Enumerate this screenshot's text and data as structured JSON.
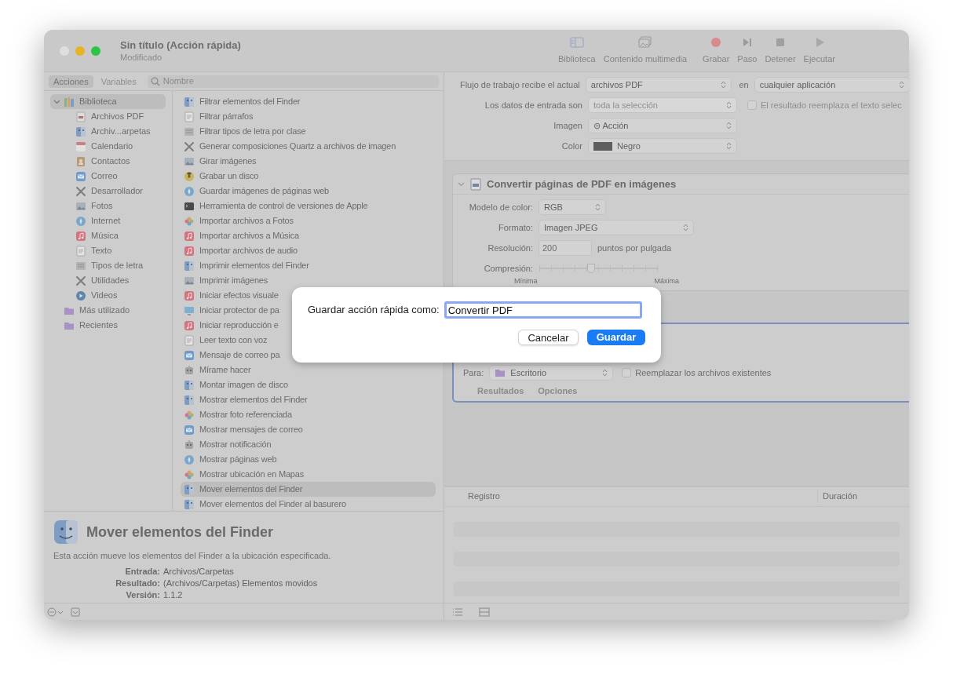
{
  "window": {
    "title": "Sin título (Acción rápida)",
    "subtitle": "Modificado"
  },
  "toolbar": [
    {
      "label": "Biblioteca",
      "kind": "library"
    },
    {
      "label": "Contenido multimedia",
      "kind": "media"
    },
    {
      "label": "Grabar",
      "kind": "record"
    },
    {
      "label": "Paso",
      "kind": "step"
    },
    {
      "label": "Detener",
      "kind": "stop"
    },
    {
      "label": "Ejecutar",
      "kind": "run"
    }
  ],
  "library_tabs": [
    {
      "label": "Acciones",
      "selected": true
    },
    {
      "label": "Variables",
      "selected": false
    }
  ],
  "search": {
    "placeholder": "Nombre"
  },
  "library": [
    {
      "label": "Biblioteca",
      "kind": "library",
      "selected": true,
      "expanded": true,
      "children": [
        {
          "label": "Archivos PDF",
          "kind": "pdf"
        },
        {
          "label": "Archiv...arpetas",
          "kind": "finder"
        },
        {
          "label": "Calendario",
          "kind": "calendar"
        },
        {
          "label": "Contactos",
          "kind": "contacts"
        },
        {
          "label": "Correo",
          "kind": "mail"
        },
        {
          "label": "Desarrollador",
          "kind": "tools"
        },
        {
          "label": "Fotos",
          "kind": "preview"
        },
        {
          "label": "Internet",
          "kind": "safari"
        },
        {
          "label": "Música",
          "kind": "music"
        },
        {
          "label": "Texto",
          "kind": "text"
        },
        {
          "label": "Tipos de letra",
          "kind": "font"
        },
        {
          "label": "Utilidades",
          "kind": "tools"
        },
        {
          "label": "Videos",
          "kind": "video"
        }
      ]
    },
    {
      "label": "Más utilizado",
      "kind": "folder",
      "selected": false
    },
    {
      "label": "Recientes",
      "kind": "folder",
      "selected": false
    }
  ],
  "actions": [
    {
      "label": "Filtrar elementos del Finder",
      "kind": "finder",
      "selected": false
    },
    {
      "label": "Filtrar párrafos",
      "kind": "text",
      "selected": false
    },
    {
      "label": "Filtrar tipos de letra por clase",
      "kind": "font",
      "selected": false
    },
    {
      "label": "Generar composiciones Quartz a archivos de imagen",
      "kind": "tools",
      "selected": false
    },
    {
      "label": "Girar imágenes",
      "kind": "preview",
      "selected": false
    },
    {
      "label": "Grabar un disco",
      "kind": "disc",
      "selected": false
    },
    {
      "label": "Guardar imágenes de páginas web",
      "kind": "safari",
      "selected": false
    },
    {
      "label": "Herramienta de control de versiones de Apple",
      "kind": "terminal",
      "selected": false
    },
    {
      "label": "Importar archivos a Fotos",
      "kind": "photos",
      "selected": false
    },
    {
      "label": "Importar archivos a Música",
      "kind": "music",
      "selected": false
    },
    {
      "label": "Importar archivos de audio",
      "kind": "music",
      "selected": false
    },
    {
      "label": "Imprimir elementos del Finder",
      "kind": "finder",
      "selected": false
    },
    {
      "label": "Imprimir imágenes",
      "kind": "preview",
      "selected": false
    },
    {
      "label": "Iniciar efectos visuale",
      "kind": "music",
      "selected": false
    },
    {
      "label": "Iniciar protector de pa",
      "kind": "screen",
      "selected": false
    },
    {
      "label": "Iniciar reproducción e",
      "kind": "music",
      "selected": false
    },
    {
      "label": "Leer texto con voz",
      "kind": "text",
      "selected": false
    },
    {
      "label": "Mensaje de correo pa",
      "kind": "mail",
      "selected": false
    },
    {
      "label": "Mírame hacer",
      "kind": "robot",
      "selected": false
    },
    {
      "label": "Montar imagen de disco",
      "kind": "finder",
      "selected": false
    },
    {
      "label": "Mostrar elementos del Finder",
      "kind": "finder",
      "selected": false
    },
    {
      "label": "Mostrar foto referenciada",
      "kind": "photos",
      "selected": false
    },
    {
      "label": "Mostrar mensajes de correo",
      "kind": "mail",
      "selected": false
    },
    {
      "label": "Mostrar notificación",
      "kind": "robot",
      "selected": false
    },
    {
      "label": "Mostrar páginas web",
      "kind": "safari",
      "selected": false
    },
    {
      "label": "Mostrar ubicación en Mapas",
      "kind": "photos",
      "selected": false
    },
    {
      "label": "Mover elementos del Finder",
      "kind": "finder",
      "selected": true
    },
    {
      "label": "Mover elementos del Finder al basurero",
      "kind": "finder",
      "selected": false
    }
  ],
  "description": {
    "title": "Mover elementos del Finder",
    "text": "Esta acción mueve los elementos del Finder a la ubicación especificada.",
    "fields": [
      {
        "label": "Entrada:",
        "value": "Archivos/Carpetas"
      },
      {
        "label": "Resultado:",
        "value": "(Archivos/Carpetas) Elementos movidos"
      },
      {
        "label": "Versión:",
        "value": "1.1.2"
      }
    ]
  },
  "workflow_settings": [
    {
      "label": "Flujo de trabajo recibe el actual",
      "value": "archivos PDF",
      "disabled": false,
      "extra_label": "en",
      "extra_value": "cualquier aplicación"
    },
    {
      "label": "Los datos de entrada son",
      "value": "toda la selección",
      "disabled": true,
      "checkbox": {
        "label": "El resultado reemplaza el texto selec",
        "checked": false
      }
    },
    {
      "label": "Imagen",
      "value": "⊝ Acción",
      "disabled": false
    },
    {
      "label": "Color",
      "value": "Negro",
      "disabled": false,
      "swatch": true
    }
  ],
  "action_card": {
    "title": "Convertir páginas de PDF en imágenes",
    "expanded": true,
    "color_model": {
      "label": "Modelo de color:",
      "value": "RGB"
    },
    "format": {
      "label": "Formato:",
      "value": "Imagen JPEG"
    },
    "resolution": {
      "label": "Resolución:",
      "value": "200",
      "unit": "puntos por pulgada"
    },
    "compression": {
      "label": "Compresión:",
      "level": 0.43,
      "min_label": "Mínima",
      "max_label": "Máxima"
    }
  },
  "second_card": {
    "selected": true,
    "to_label": "Para:",
    "to_value": "Escritorio",
    "checkbox": {
      "label": "Reemplazar los archivos existentes",
      "checked": false
    },
    "tabs": [
      "Resultados",
      "Opciones"
    ]
  },
  "log": {
    "columns": [
      "Registro",
      "Duración"
    ]
  },
  "dialog": {
    "label": "Guardar acción rápida como:",
    "value": "Convertir PDF",
    "buttons": [
      {
        "label": "Cancelar",
        "kind": "secondary"
      },
      {
        "label": "Guardar",
        "kind": "primary"
      }
    ]
  }
}
